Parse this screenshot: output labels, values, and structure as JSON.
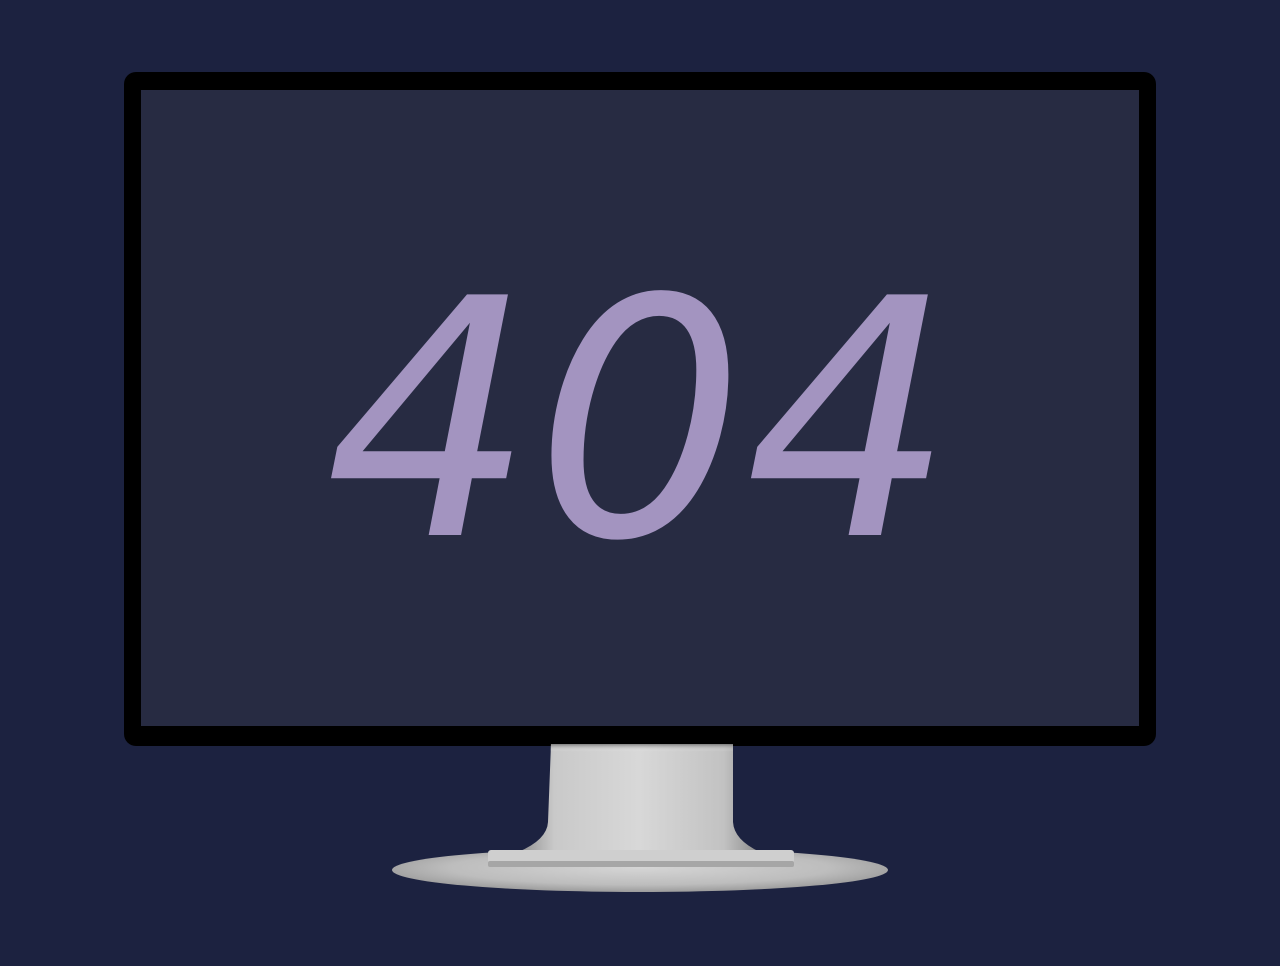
{
  "error": {
    "code": "404"
  },
  "colors": {
    "background": "#1c2240",
    "bezel": "#000000",
    "screen": "#272b42",
    "code_text": "#a394c0",
    "stand": "#b9b9b9"
  }
}
